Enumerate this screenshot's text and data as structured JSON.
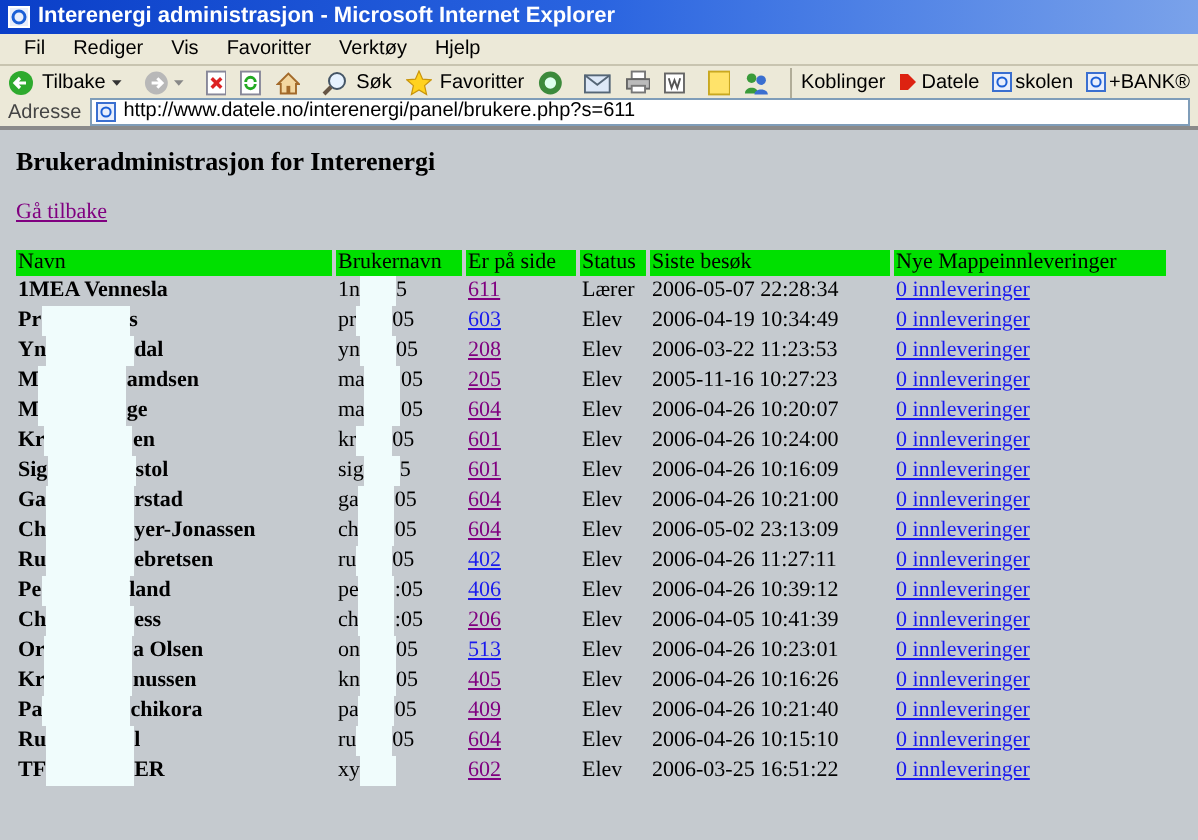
{
  "window": {
    "title": "Interenergi administrasjon - Microsoft Internet Explorer"
  },
  "menu": [
    "Fil",
    "Rediger",
    "Vis",
    "Favoritter",
    "Verktøy",
    "Hjelp"
  ],
  "toolbar": {
    "back": "Tilbake",
    "search": "Søk",
    "favorites": "Favoritter"
  },
  "links_bar": {
    "label": "Koblinger",
    "links": [
      "Datele",
      "skolen",
      "+BANK®"
    ]
  },
  "address_bar": {
    "label": "Adresse",
    "url": "http://www.datele.no/interenergi/panel/brukere.php?s=611"
  },
  "page": {
    "heading": "Brukeradministrasjon for Interenergi",
    "back_link": "Gå tilbake",
    "table": {
      "columns": [
        "Navn",
        "Brukernavn",
        "Er på side",
        "Status",
        "Siste besøk",
        "Nye Mappeinnleveringer"
      ],
      "rows": [
        {
          "name": {
            "start": "1MEA Vennesla"
          },
          "username": {
            "start": "1n",
            "end": "5"
          },
          "page": "611",
          "visited": true,
          "status": "Lærer",
          "last_visit": "2006-05-07 22:28:34",
          "deliveries": "0 innleveringer"
        },
        {
          "name": {
            "start": "Pr",
            "end": "s"
          },
          "username": {
            "start": "pr",
            "end": "05"
          },
          "page": "603",
          "visited": false,
          "status": "Elev",
          "last_visit": "2006-04-19 10:34:49",
          "deliveries": "0 innleveringer"
        },
        {
          "name": {
            "start": "Yn",
            "end": "dal"
          },
          "username": {
            "start": "yn",
            "end": "05"
          },
          "page": "208",
          "visited": true,
          "status": "Elev",
          "last_visit": "2006-03-22 11:23:53",
          "deliveries": "0 innleveringer"
        },
        {
          "name": {
            "start": "M",
            "end": "amdsen"
          },
          "username": {
            "start": "ma",
            "end": "05"
          },
          "page": "205",
          "visited": true,
          "status": "Elev",
          "last_visit": "2005-11-16 10:27:23",
          "deliveries": "0 innleveringer"
        },
        {
          "name": {
            "start": "M",
            "end": "ge"
          },
          "username": {
            "start": "ma",
            "end": "05"
          },
          "page": "604",
          "visited": true,
          "status": "Elev",
          "last_visit": "2006-04-26 10:20:07",
          "deliveries": "0 innleveringer"
        },
        {
          "name": {
            "start": "Kr",
            "end": "en"
          },
          "username": {
            "start": "kr",
            "end": "05"
          },
          "page": "601",
          "visited": true,
          "status": "Elev",
          "last_visit": "2006-04-26 10:24:00",
          "deliveries": "0 innleveringer"
        },
        {
          "name": {
            "start": "Sig",
            "end": "stol"
          },
          "username": {
            "start": "sig",
            "end": "5"
          },
          "page": "601",
          "visited": true,
          "status": "Elev",
          "last_visit": "2006-04-26 10:16:09",
          "deliveries": "0 innleveringer"
        },
        {
          "name": {
            "start": "Ga",
            "end": "rstad"
          },
          "username": {
            "start": "ga",
            "end": "05"
          },
          "page": "604",
          "visited": true,
          "status": "Elev",
          "last_visit": "2006-04-26 10:21:00",
          "deliveries": "0 innleveringer"
        },
        {
          "name": {
            "start": "Ch",
            "end": "yer-Jonassen"
          },
          "username": {
            "start": "ch",
            "end": "05"
          },
          "page": "604",
          "visited": true,
          "status": "Elev",
          "last_visit": "2006-05-02 23:13:09",
          "deliveries": "0 innleveringer"
        },
        {
          "name": {
            "start": "Ru",
            "end": "ebretsen"
          },
          "username": {
            "start": "ru",
            "end": "05"
          },
          "page": "402",
          "visited": false,
          "status": "Elev",
          "last_visit": "2006-04-26 11:27:11",
          "deliveries": "0 innleveringer"
        },
        {
          "name": {
            "start": "Pe",
            "end": "land"
          },
          "username": {
            "start": "pe",
            "end": ":05"
          },
          "page": "406",
          "visited": false,
          "status": "Elev",
          "last_visit": "2006-04-26 10:39:12",
          "deliveries": "0 innleveringer"
        },
        {
          "name": {
            "start": "Ch",
            "end": "ess"
          },
          "username": {
            "start": "ch",
            "end": ":05"
          },
          "page": "206",
          "visited": true,
          "status": "Elev",
          "last_visit": "2006-04-05 10:41:39",
          "deliveries": "0 innleveringer"
        },
        {
          "name": {
            "start": "Or",
            "end": "a Olsen"
          },
          "username": {
            "start": "on",
            "end": "05"
          },
          "page": "513",
          "visited": false,
          "status": "Elev",
          "last_visit": "2006-04-26 10:23:01",
          "deliveries": "0 innleveringer"
        },
        {
          "name": {
            "start": "Kr",
            "end": "nussen"
          },
          "username": {
            "start": "kn",
            "end": "05"
          },
          "page": "405",
          "visited": true,
          "status": "Elev",
          "last_visit": "2006-04-26 10:16:26",
          "deliveries": "0 innleveringer"
        },
        {
          "name": {
            "start": "Pa",
            "end": "chikora"
          },
          "username": {
            "start": "pa",
            "end": "05"
          },
          "page": "409",
          "visited": true,
          "status": "Elev",
          "last_visit": "2006-04-26 10:21:40",
          "deliveries": "0 innleveringer"
        },
        {
          "name": {
            "start": "Ru",
            "end": "l"
          },
          "username": {
            "start": "ru",
            "end": "05"
          },
          "page": "604",
          "visited": true,
          "status": "Elev",
          "last_visit": "2006-04-26 10:15:10",
          "deliveries": "0 innleveringer"
        },
        {
          "name": {
            "start": "TF",
            "end": "ER"
          },
          "username": {
            "start": "xy",
            "redacted": true
          },
          "page": "602",
          "visited": true,
          "status": "Elev",
          "last_visit": "2006-03-25 16:51:22",
          "deliveries": "0 innleveringer"
        }
      ]
    }
  }
}
